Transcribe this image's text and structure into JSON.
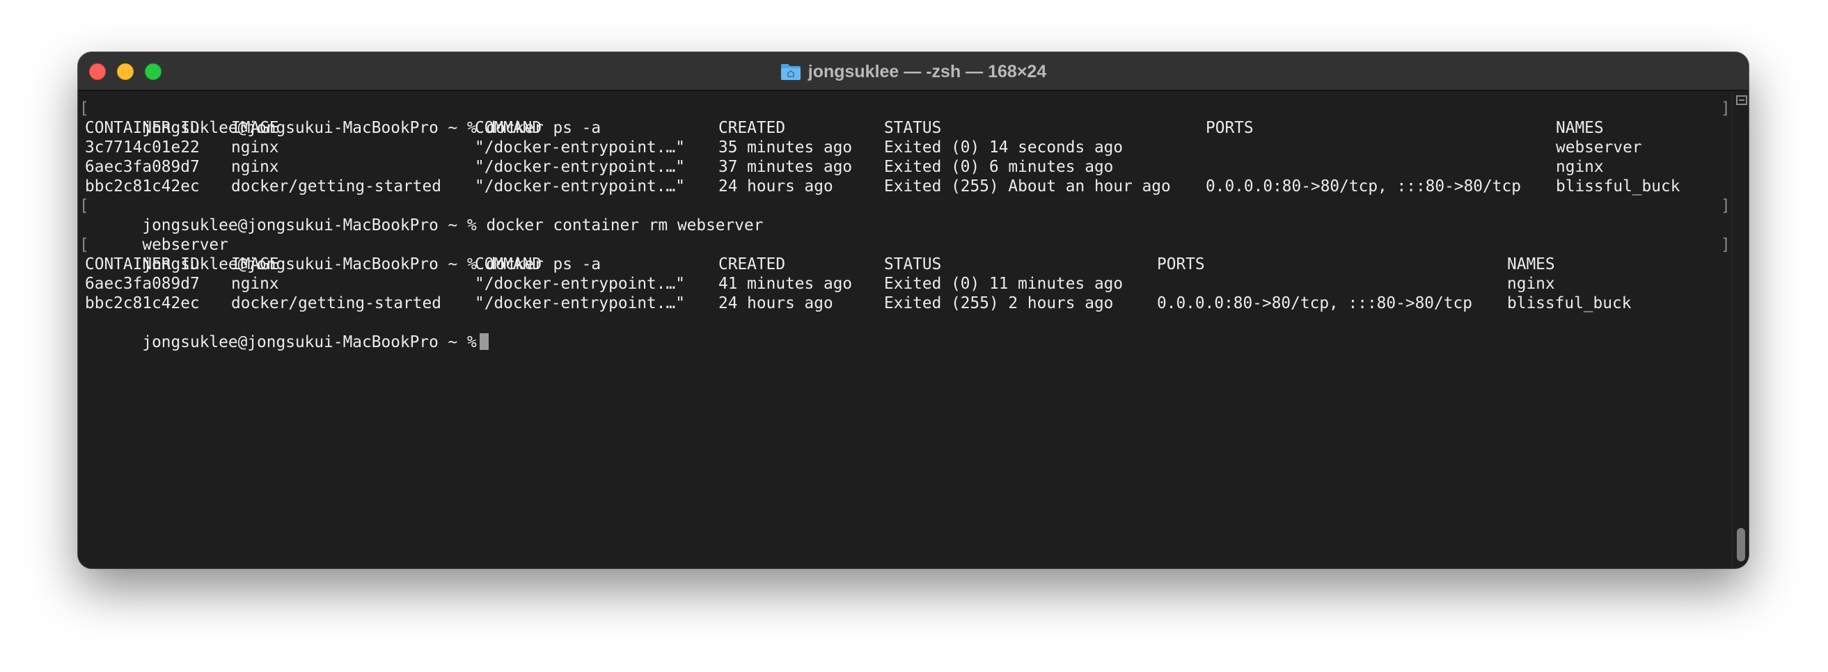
{
  "window": {
    "title": "jongsuklee — -zsh — 168×24",
    "folder_icon": "folder-icon"
  },
  "terminal": {
    "session1": {
      "prompt": "jongsuklee@jongsukui-MacBookPro ~ % docker ps -a",
      "headers": [
        "CONTAINER ID",
        "IMAGE",
        "COMMAND",
        "CREATED",
        "STATUS",
        "PORTS",
        "NAMES"
      ],
      "rows": [
        [
          "3c7714c01e22",
          "nginx",
          "\"/docker-entrypoint.…\"",
          "35 minutes ago",
          "Exited (0) 14 seconds ago",
          "",
          "webserver"
        ],
        [
          "6aec3fa089d7",
          "nginx",
          "\"/docker-entrypoint.…\"",
          "37 minutes ago",
          "Exited (0) 6 minutes ago",
          "",
          "nginx"
        ],
        [
          "bbc2c81c42ec",
          "docker/getting-started",
          "\"/docker-entrypoint.…\"",
          "24 hours ago",
          "Exited (255) About an hour ago",
          "0.0.0.0:80->80/tcp, :::80->80/tcp",
          "blissful_buck"
        ]
      ]
    },
    "session2": {
      "prompt": "jongsuklee@jongsukui-MacBookPro ~ % docker container rm webserver",
      "output": "webserver"
    },
    "session3": {
      "prompt": "jongsuklee@jongsukui-MacBookPro ~ % docker ps -a",
      "headers": [
        "CONTAINER ID",
        "IMAGE",
        "COMMAND",
        "CREATED",
        "STATUS",
        "PORTS",
        "NAMES"
      ],
      "rows": [
        [
          "6aec3fa089d7",
          "nginx",
          "\"/docker-entrypoint.…\"",
          "41 minutes ago",
          "Exited (0) 11 minutes ago",
          "",
          "nginx"
        ],
        [
          "bbc2c81c42ec",
          "docker/getting-started",
          "\"/docker-entrypoint.…\"",
          "24 hours ago",
          "Exited (255) 2 hours ago",
          "0.0.0.0:80->80/tcp, :::80->80/tcp",
          "blissful_buck"
        ]
      ]
    },
    "current_prompt": "jongsuklee@jongsukui-MacBookPro ~ %"
  }
}
